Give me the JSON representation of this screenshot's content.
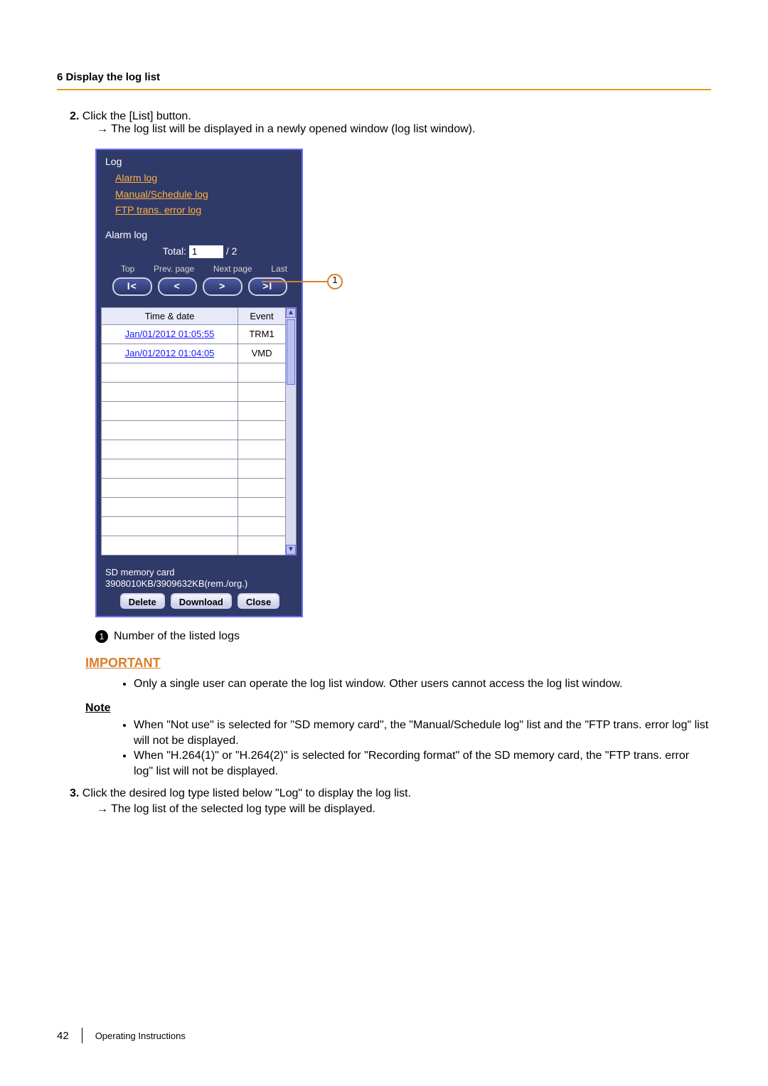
{
  "header": {
    "section_title": "6 Display the log list"
  },
  "steps": {
    "s2_num": "2.",
    "s2_text": "Click the [List] button.",
    "s2_arrow": "→ The log list will be displayed in a newly opened window (log list window).",
    "s3_num": "3.",
    "s3_text": "Click the desired log type listed below \"Log\" to display the log list.",
    "s3_arrow": "→ The log list of the selected log type will be displayed."
  },
  "panel": {
    "title": "Log",
    "links": {
      "alarm": "Alarm log",
      "manual": "Manual/Schedule log",
      "ftp": "FTP trans. error log"
    },
    "sub_title": "Alarm log",
    "total_label": "Total:",
    "total_value": "1",
    "total_suffix": "/ 2",
    "nav": {
      "top": "Top",
      "prev": "Prev. page",
      "next": "Next page",
      "last": "Last"
    },
    "table": {
      "col_dt": "Time & date",
      "col_ev": "Event",
      "rows": [
        {
          "dt": "Jan/01/2012 01:05:55",
          "ev": "TRM1"
        },
        {
          "dt": "Jan/01/2012 01:04:05",
          "ev": "VMD"
        }
      ],
      "empty_rows": 10
    },
    "sd": {
      "label": "SD memory card",
      "info": "3908010KB/3909632KB(rem./org.)",
      "delete": "Delete",
      "download": "Download",
      "close": "Close"
    }
  },
  "callout": {
    "num": "1",
    "legend_num": "1",
    "legend_text": "Number of the listed logs"
  },
  "important": {
    "title": "IMPORTANT",
    "bullet": "Only a single user can operate the log list window. Other users cannot access the log list window."
  },
  "note": {
    "title": "Note",
    "b1": "When \"Not use\" is selected for \"SD memory card\", the \"Manual/Schedule log\" list and the \"FTP trans. error log\" list will not be displayed.",
    "b2": "When \"H.264(1)\" or \"H.264(2)\" is selected for \"Recording format\" of the SD memory card, the \"FTP trans. error log\" list will not be displayed."
  },
  "footer": {
    "page": "42",
    "doc": "Operating Instructions"
  }
}
